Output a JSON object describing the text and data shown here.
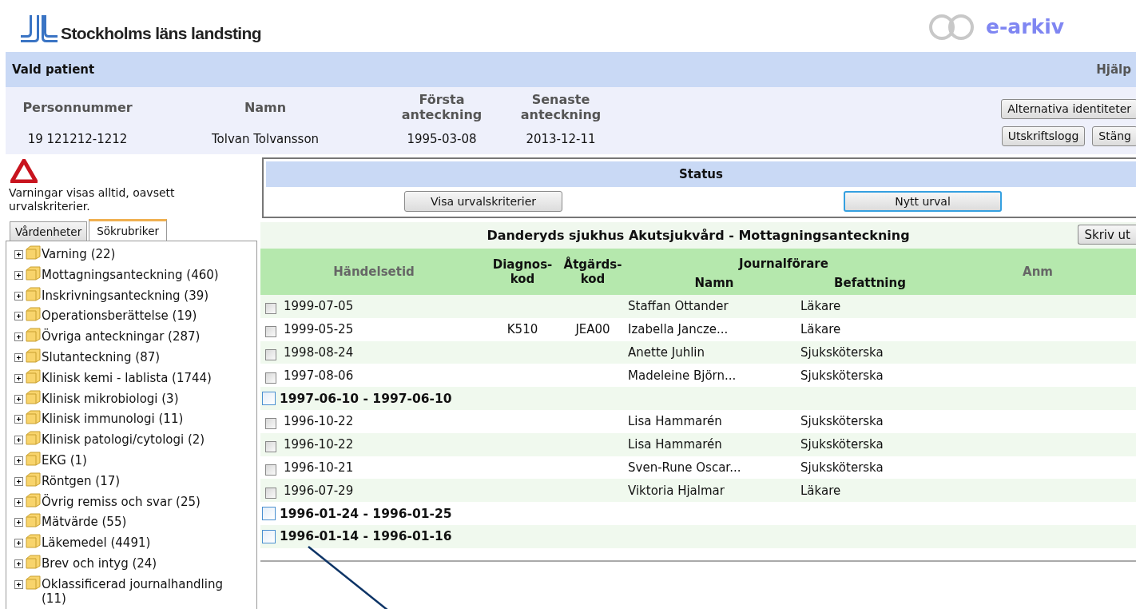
{
  "header": {
    "org_name": "Stockholms läns landsting",
    "app_name": "e-arkiv"
  },
  "patient_bar": {
    "title": "Vald patient",
    "help_link": "Hjälp"
  },
  "patient": {
    "columns": [
      "Personnummer",
      "Namn",
      "Första anteckning",
      "Senaste anteckning"
    ],
    "values": [
      "19 121212-1212",
      "Tolvan Tolvansson",
      "1995-03-08",
      "2013-12-11"
    ]
  },
  "patient_buttons": [
    {
      "label": "Alternativa identiteter"
    },
    {
      "label": "Utskriftslogg"
    },
    {
      "label": "Stäng"
    }
  ],
  "warning_note": "Varningar visas alltid, oavsett urvalskriterier.",
  "tabs": [
    {
      "label": "Vårdenheter",
      "selected": false
    },
    {
      "label": "Sökrubriker",
      "selected": true
    }
  ],
  "tree": [
    {
      "label": "Varning (22)",
      "expanded": false
    },
    {
      "label": "Mottagningsanteckning (460)",
      "expanded": false
    },
    {
      "label": "Inskrivningsanteckning (39)",
      "expanded": false
    },
    {
      "label": "Operationsberättelse (19)",
      "expanded": false
    },
    {
      "label": "Övriga anteckningar (287)",
      "expanded": false
    },
    {
      "label": "Slutanteckning (87)",
      "expanded": false
    },
    {
      "label": "Klinisk kemi - lablista (1744)",
      "expanded": false
    },
    {
      "label": "Klinisk mikrobiologi (3)",
      "expanded": false
    },
    {
      "label": "Klinisk immunologi (11)",
      "expanded": false
    },
    {
      "label": "Klinisk patologi/cytologi (2)",
      "expanded": false
    },
    {
      "label": "EKG (1)",
      "expanded": false
    },
    {
      "label": "Röntgen (17)",
      "expanded": false
    },
    {
      "label": "Övrig remiss och svar (25)",
      "expanded": false
    },
    {
      "label": "Mätvärde (55)",
      "expanded": false
    },
    {
      "label": "Läkemedel (4491)",
      "expanded": false
    },
    {
      "label": "Brev och intyg (24)",
      "expanded": false
    },
    {
      "label": "Oklassificerad journalhandling (11)",
      "expanded": false
    }
  ],
  "status": {
    "title": "Status",
    "buttons": [
      {
        "label": "Visa urvalskriterier",
        "focused": false
      },
      {
        "label": "Nytt urval",
        "focused": true
      }
    ]
  },
  "result": {
    "title": "Danderyds sjukhus Akutsjukvård - Mottagningsanteckning",
    "print_button": "Skriv ut",
    "columns": {
      "event_time": "Händelsetid",
      "diagnosis_code": "Diagnos-kod",
      "procedure_code": "Åtgärds-kod",
      "author_group": "Journalförare",
      "author_name": "Namn",
      "author_role": "Befattning",
      "remark": "Anm"
    },
    "rows": [
      {
        "kind": "entry",
        "checked": false,
        "date": "1999-07-05",
        "name": "Staffan Ottander",
        "role": "Läkare"
      },
      {
        "kind": "entry",
        "checked": false,
        "date": "1999-05-25",
        "diagnosis_code": "K510",
        "procedure_code": "JEA00",
        "name": "Izabella Jancze...",
        "role": "Läkare"
      },
      {
        "kind": "entry",
        "checked": false,
        "date": "1998-08-24",
        "name": "Anette Juhlin",
        "role": "Sjuksköterska"
      },
      {
        "kind": "entry",
        "checked": false,
        "date": "1997-08-06",
        "name": "Madeleine Björn...",
        "role": "Sjuksköterska"
      },
      {
        "kind": "group",
        "checked": false,
        "date": "1997-06-10 - 1997-06-10"
      },
      {
        "kind": "entry",
        "checked": false,
        "date": "1996-10-22",
        "name": "Lisa Hammarén",
        "role": "Sjuksköterska"
      },
      {
        "kind": "entry",
        "checked": false,
        "date": "1996-10-22",
        "name": "Lisa Hammarén",
        "role": "Sjuksköterska"
      },
      {
        "kind": "entry",
        "checked": false,
        "date": "1996-10-21",
        "name": "Sven-Rune Oscar...",
        "role": "Sjuksköterska"
      },
      {
        "kind": "entry",
        "checked": false,
        "date": "1996-07-29",
        "name": "Viktoria Hjalmar",
        "role": "Läkare"
      },
      {
        "kind": "group",
        "checked": false,
        "date": "1996-01-24 - 1996-01-25"
      },
      {
        "kind": "group",
        "checked": false,
        "date": "1996-01-14 - 1996-01-16"
      }
    ]
  }
}
